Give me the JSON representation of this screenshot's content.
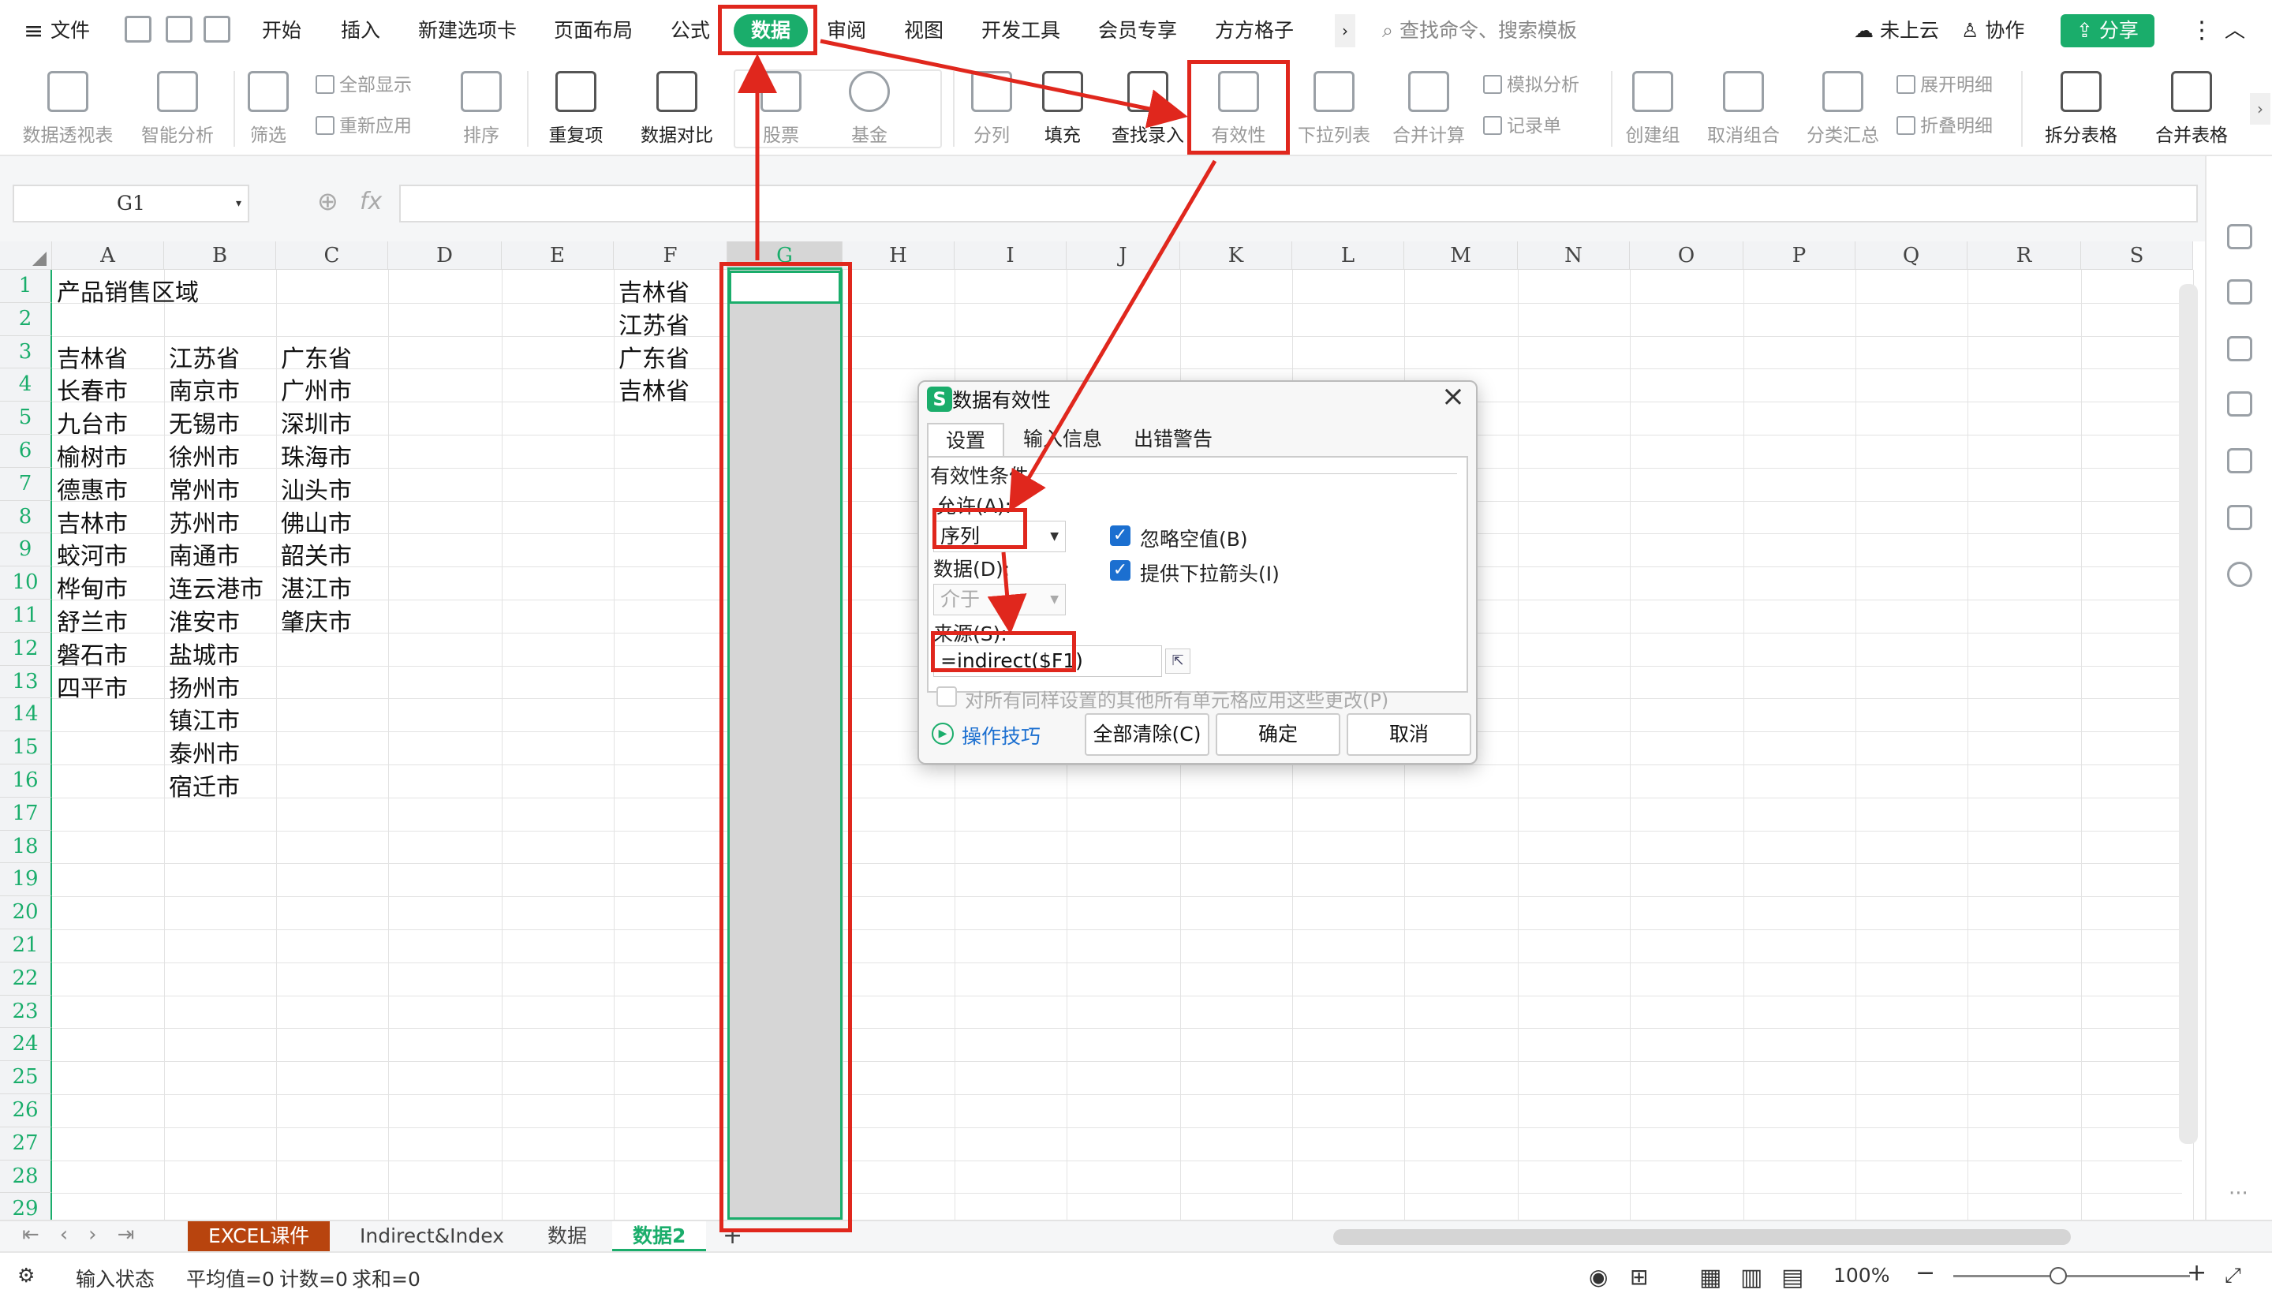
{
  "menubar": {
    "file": "文件",
    "tabs": [
      "开始",
      "插入",
      "新建选项卡",
      "页面布局",
      "公式",
      "数据",
      "审阅",
      "视图",
      "开发工具",
      "会员专享",
      "方方格子"
    ],
    "search_placeholder": "查找命令、搜索模板",
    "cloud": "未上云",
    "collab": "协作",
    "share": "分享"
  },
  "ribbon": {
    "pivot": "数据透视表",
    "smart": "智能分析",
    "filter": "筛选",
    "show_all": "全部显示",
    "reapply": "重新应用",
    "sort": "排序",
    "dup": "重复项",
    "compare": "数据对比",
    "stock": "股票",
    "fund": "基金",
    "split": "分列",
    "fill": "填充",
    "lookup": "查找录入",
    "validity": "有效性",
    "dropdown": "下拉列表",
    "merge_calc": "合并计算",
    "simulate": "模拟分析",
    "record": "记录单",
    "create_group": "创建组",
    "ungroup": "取消组合",
    "subtotal": "分类汇总",
    "expand": "展开明细",
    "collapse": "折叠明细",
    "split_table": "拆分表格",
    "merge_table": "合并表格"
  },
  "formula": {
    "cell_ref": "G1",
    "fx": "fx"
  },
  "grid": {
    "columns": [
      "A",
      "B",
      "C",
      "D",
      "E",
      "F",
      "G",
      "H",
      "I",
      "J",
      "K",
      "L",
      "M",
      "N",
      "O",
      "P",
      "Q",
      "R",
      "S"
    ],
    "rows": [
      "1",
      "2",
      "3",
      "4",
      "5",
      "6",
      "7",
      "8",
      "9",
      "10",
      "11",
      "12",
      "13",
      "14",
      "15",
      "16",
      "17",
      "18",
      "19",
      "20",
      "21",
      "22",
      "23",
      "24",
      "25",
      "26",
      "27",
      "28",
      "29"
    ],
    "title": "产品销售区域",
    "col_a": [
      "吉林省",
      "长春市",
      "九台市",
      "榆树市",
      "德惠市",
      "吉林市",
      "蛟河市",
      "桦甸市",
      "舒兰市",
      "磐石市",
      "四平市"
    ],
    "col_b": [
      "江苏省",
      "南京市",
      "无锡市",
      "徐州市",
      "常州市",
      "苏州市",
      "南通市",
      "连云港市",
      "淮安市",
      "盐城市",
      "扬州市",
      "镇江市",
      "泰州市",
      "宿迁市"
    ],
    "col_c": [
      "广东省",
      "广州市",
      "深圳市",
      "珠海市",
      "汕头市",
      "佛山市",
      "韶关市",
      "湛江市",
      "肇庆市"
    ],
    "col_f": [
      "吉林省",
      "江苏省",
      "广东省",
      "吉林省"
    ]
  },
  "dialog": {
    "title": "数据有效性",
    "tabs": [
      "设置",
      "输入信息",
      "出错警告"
    ],
    "section": "有效性条件",
    "allow_label": "允许(A):",
    "allow_value": "序列",
    "data_label": "数据(D):",
    "data_value": "介于",
    "ignore_blank": "忽略空值(B)",
    "dropdown_arrow": "提供下拉箭头(I)",
    "source_label": "来源(S):",
    "source_value": "=indirect($F1)",
    "apply_all": "对所有同样设置的其他所有单元格应用这些更改(P)",
    "tips": "操作技巧",
    "clear_all": "全部清除(C)",
    "ok": "确定",
    "cancel": "取消"
  },
  "sheets": {
    "tabs": [
      "EXCEL课件",
      "Indirect&Index",
      "数据",
      "数据2"
    ],
    "add": "+"
  },
  "status": {
    "mode": "输入状态",
    "avg": "平均值=0",
    "count": "计数=0",
    "sum": "求和=0",
    "zoom": "100%"
  },
  "colors": {
    "accent": "#1aad6b",
    "annotation": "#e0271d",
    "checkbox": "#1b6fd0",
    "selection_fill": "#d6d6d6"
  }
}
